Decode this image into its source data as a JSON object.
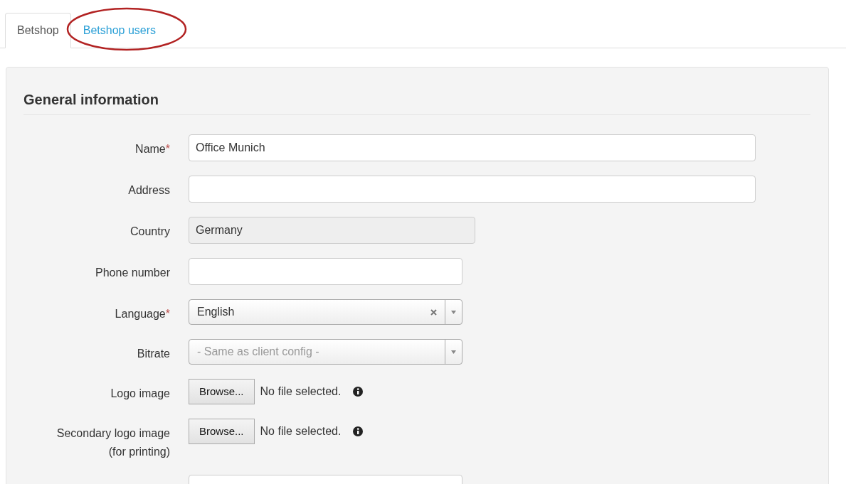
{
  "tabs": [
    {
      "label": "Betshop",
      "selected": true,
      "circled": false
    },
    {
      "label": "Betshop users",
      "selected": false,
      "circled": true
    }
  ],
  "section": {
    "title": "General information"
  },
  "fields": [
    {
      "kind": "text",
      "label": "Name",
      "required_mark": "*",
      "value": "Office Munich"
    },
    {
      "kind": "text",
      "label": "Address"
    },
    {
      "kind": "readonly",
      "label": "Country",
      "value": "Germany"
    },
    {
      "kind": "text",
      "label": "Phone number"
    },
    {
      "kind": "select",
      "label": "Language",
      "required_mark": "*",
      "value": "English",
      "clearable": true
    },
    {
      "kind": "select",
      "label": "Bitrate",
      "placeholder": "- Same as client config -",
      "clearable": false
    },
    {
      "kind": "file",
      "label": "Logo image",
      "button": "Browse...",
      "status": "No file selected."
    },
    {
      "kind": "file",
      "label": "Secondary logo image",
      "label_2": "(for printing)",
      "button": "Browse...",
      "status": "No file selected."
    },
    {
      "kind": "text"
    }
  ]
}
